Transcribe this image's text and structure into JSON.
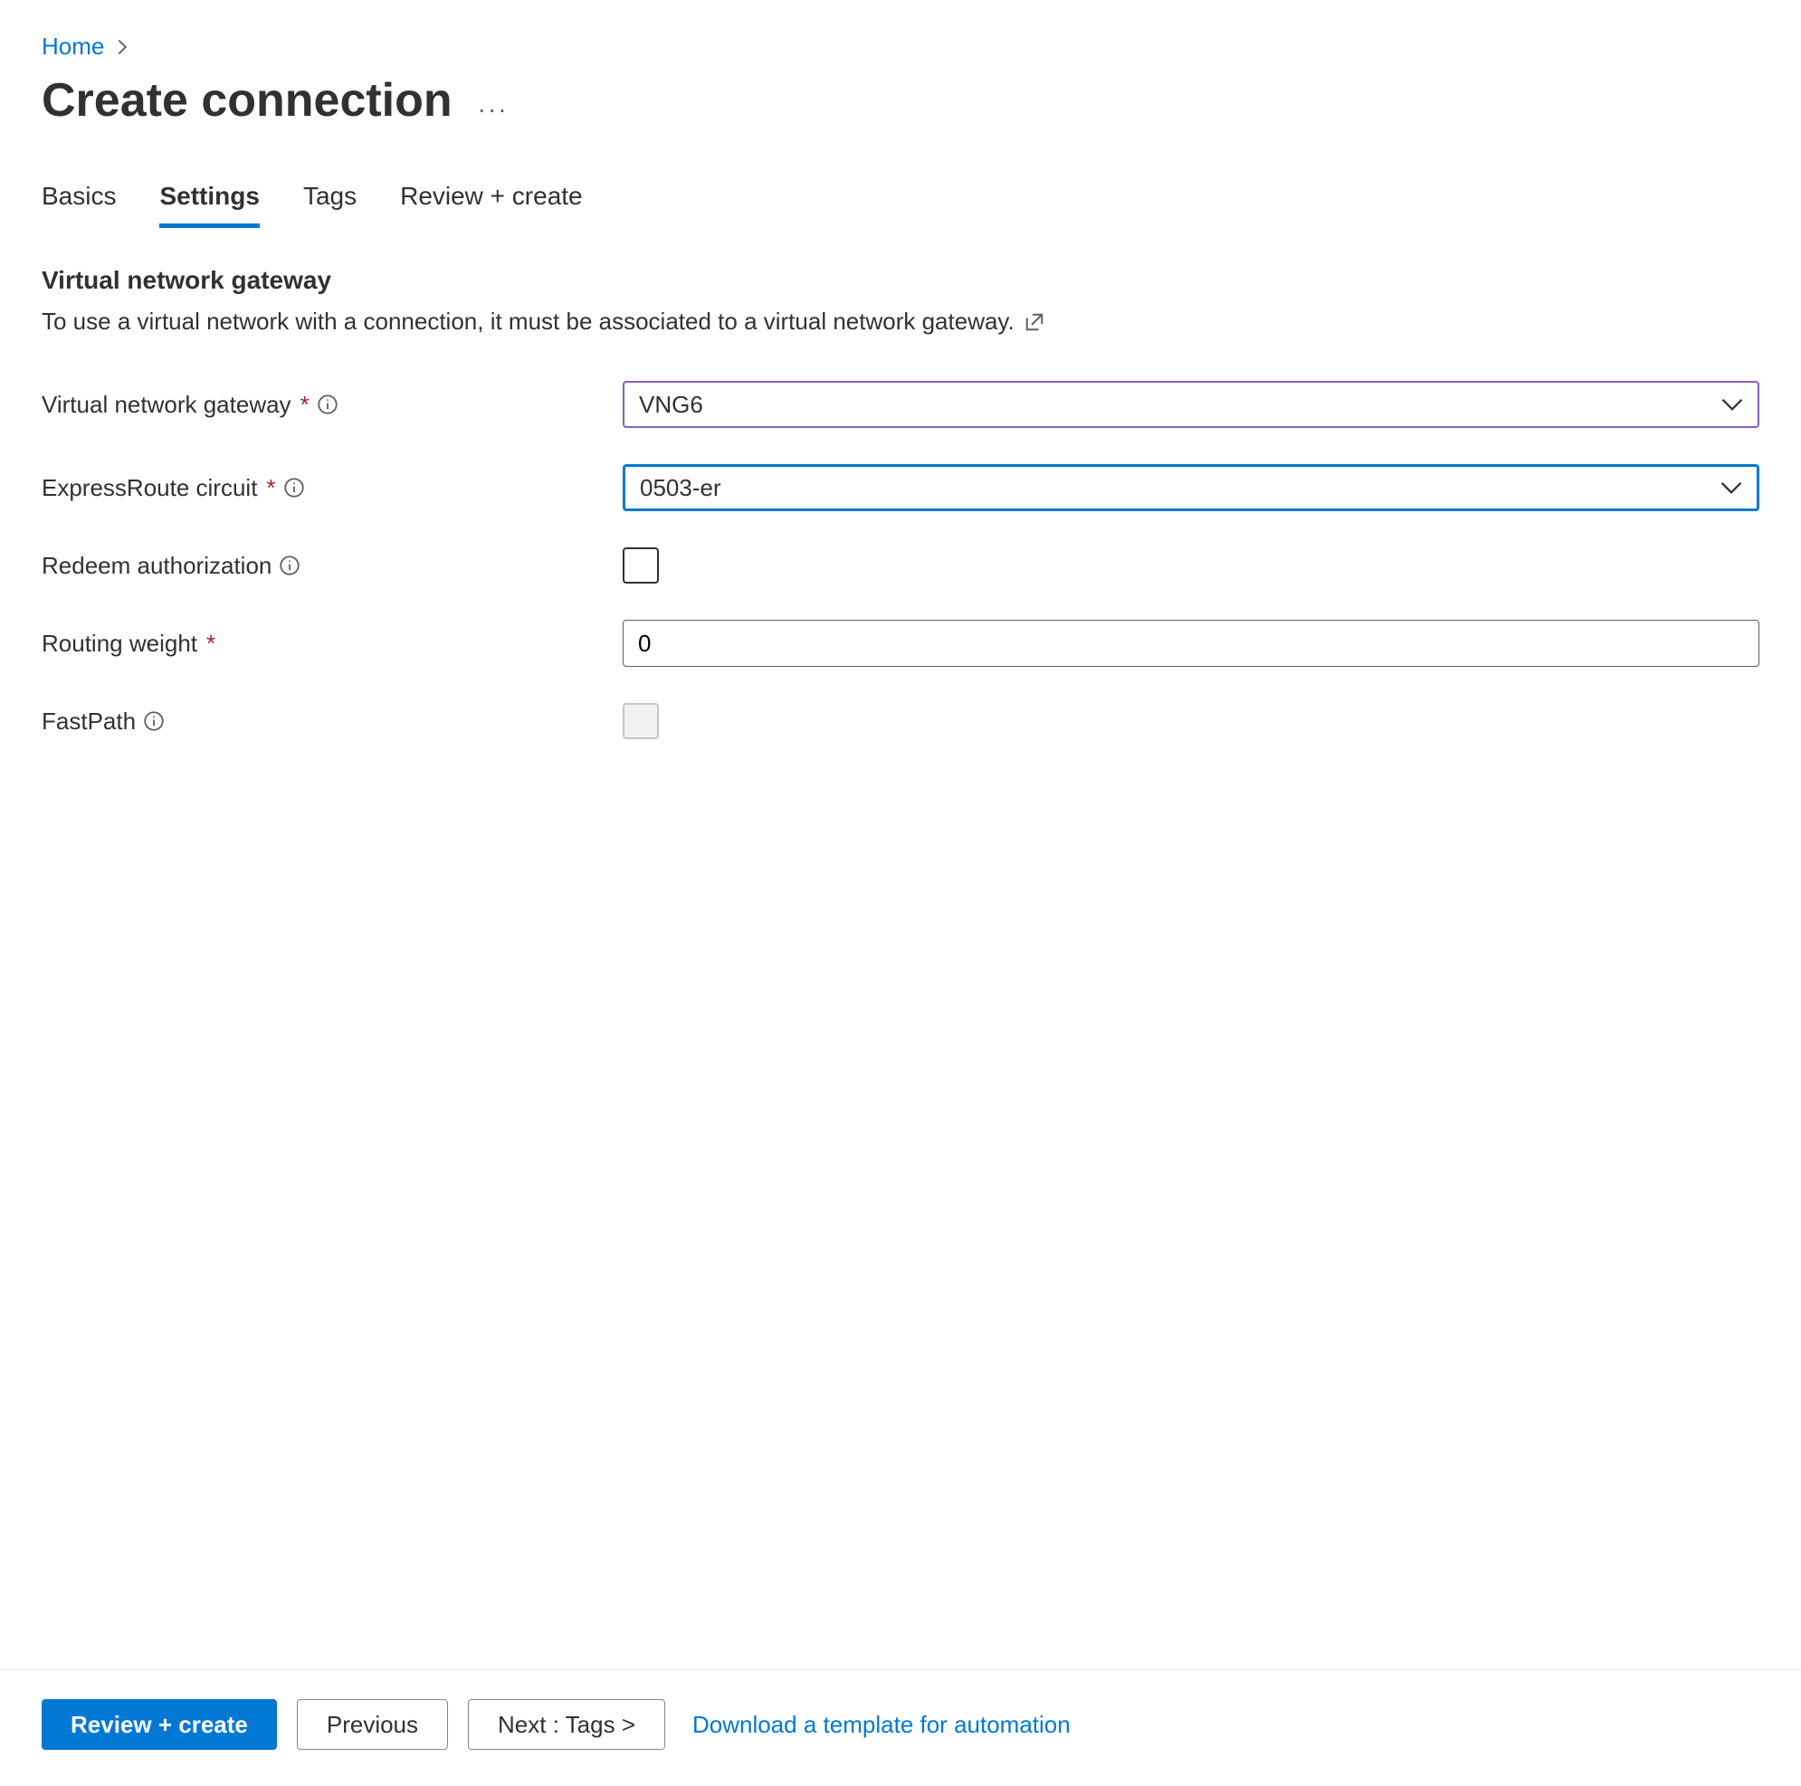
{
  "breadcrumb": {
    "home": "Home"
  },
  "page_title": "Create connection",
  "tabs": {
    "basics": "Basics",
    "settings": "Settings",
    "tags": "Tags",
    "review": "Review + create"
  },
  "section": {
    "heading": "Virtual network gateway",
    "description": "To use a virtual network with a connection, it must be associated to a virtual network gateway."
  },
  "fields": {
    "vng_label": "Virtual network gateway",
    "vng_value": "VNG6",
    "er_label": "ExpressRoute circuit",
    "er_value": "0503-er",
    "redeem_label": "Redeem authorization",
    "routing_label": "Routing weight",
    "routing_value": "0",
    "fastpath_label": "FastPath"
  },
  "footer": {
    "review": "Review + create",
    "previous": "Previous",
    "next": "Next : Tags >",
    "download": "Download a template for automation"
  }
}
